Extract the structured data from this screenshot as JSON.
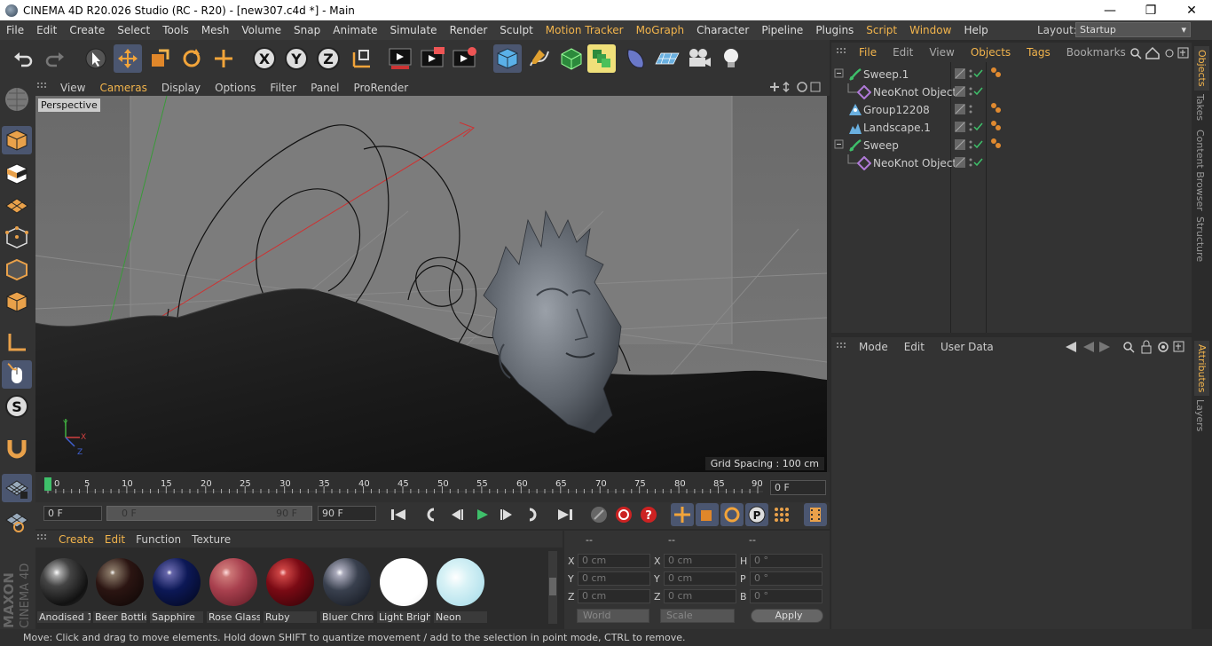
{
  "window": {
    "title": "CINEMA 4D R20.026 Studio (RC - R20) - [new307.c4d *] - Main",
    "minimize": "—",
    "maximize": "❐",
    "close": "✕"
  },
  "menu": [
    "File",
    "Edit",
    "Create",
    "Select",
    "Tools",
    "Mesh",
    "Volume",
    "Snap",
    "Animate",
    "Simulate",
    "Render",
    "Sculpt",
    "Motion Tracker",
    "MoGraph",
    "Character",
    "Pipeline",
    "Plugins",
    "Script",
    "Window",
    "Help"
  ],
  "layout": {
    "label": "Layout:",
    "value": "Startup"
  },
  "viewport": {
    "menu": [
      "View",
      "Cameras",
      "Display",
      "Options",
      "Filter",
      "Panel",
      "ProRender"
    ],
    "label": "Perspective",
    "grid_spacing": "Grid Spacing : 100 cm"
  },
  "timeline": {
    "ticks": [
      "0",
      "5",
      "10",
      "15",
      "20",
      "25",
      "30",
      "35",
      "40",
      "45",
      "50",
      "55",
      "60",
      "65",
      "70",
      "75",
      "80",
      "85",
      "90"
    ],
    "current_frame": "0 F",
    "start_frame": "0 F",
    "range_start": "0 F",
    "range_end": "90 F",
    "end_frame": "90 F"
  },
  "materials": {
    "menu": [
      "Create",
      "Edit",
      "Function",
      "Texture"
    ],
    "items": [
      {
        "label": "Anodised 1",
        "color": "#2a2a2a"
      },
      {
        "label": "Beer Bottle",
        "color": "#2b1512"
      },
      {
        "label": "Sapphire",
        "color": "#0c1856"
      },
      {
        "label": "Rose Glass",
        "color": "#a8404e"
      },
      {
        "label": "Ruby",
        "color": "#7a0a14"
      },
      {
        "label": "Bluer Chro",
        "color": "#39404e"
      },
      {
        "label": "Light Brigh",
        "color": "#ffffff"
      },
      {
        "label": "Neon",
        "color": "#b9e4ee"
      }
    ]
  },
  "coordinates": {
    "header": [
      "--",
      "--",
      "--"
    ],
    "rows": [
      {
        "a_label": "X",
        "a_val": "0 cm",
        "b_label": "X",
        "b_val": "0 cm",
        "c_label": "H",
        "c_val": "0 °"
      },
      {
        "a_label": "Y",
        "a_val": "0 cm",
        "b_label": "Y",
        "b_val": "0 cm",
        "c_label": "P",
        "c_val": "0 °"
      },
      {
        "a_label": "Z",
        "a_val": "0 cm",
        "b_label": "Z",
        "b_val": "0 cm",
        "c_label": "B",
        "c_val": "0 °"
      }
    ],
    "world": "World",
    "scale": "Scale",
    "apply": "Apply"
  },
  "objects": {
    "menu": [
      "File",
      "Edit",
      "View",
      "Objects",
      "Tags",
      "Bookmarks"
    ],
    "rows": [
      {
        "name": "Sweep.1",
        "indent": 0,
        "icon": "sweep-icon"
      },
      {
        "name": "NeoKnot Object",
        "indent": 1,
        "icon": "neoknot-icon"
      },
      {
        "name": "Group12208",
        "indent": 0,
        "icon": "group-icon"
      },
      {
        "name": "Landscape.1",
        "indent": 0,
        "icon": "landscape-icon"
      },
      {
        "name": "Sweep",
        "indent": 0,
        "icon": "sweep-icon"
      },
      {
        "name": "NeoKnot Object",
        "indent": 1,
        "icon": "neoknot-icon"
      }
    ]
  },
  "attributes": {
    "menu": [
      "Mode",
      "Edit",
      "User Data"
    ]
  },
  "right_tabs": [
    "Objects",
    "Takes",
    "Content Browser",
    "Structure",
    "Attributes",
    "Layers"
  ],
  "status": "Move: Click and drag to move elements. Hold down SHIFT to quantize movement / add to the selection in point mode, CTRL to remove.",
  "brand": "MAXON CINEMA 4D"
}
